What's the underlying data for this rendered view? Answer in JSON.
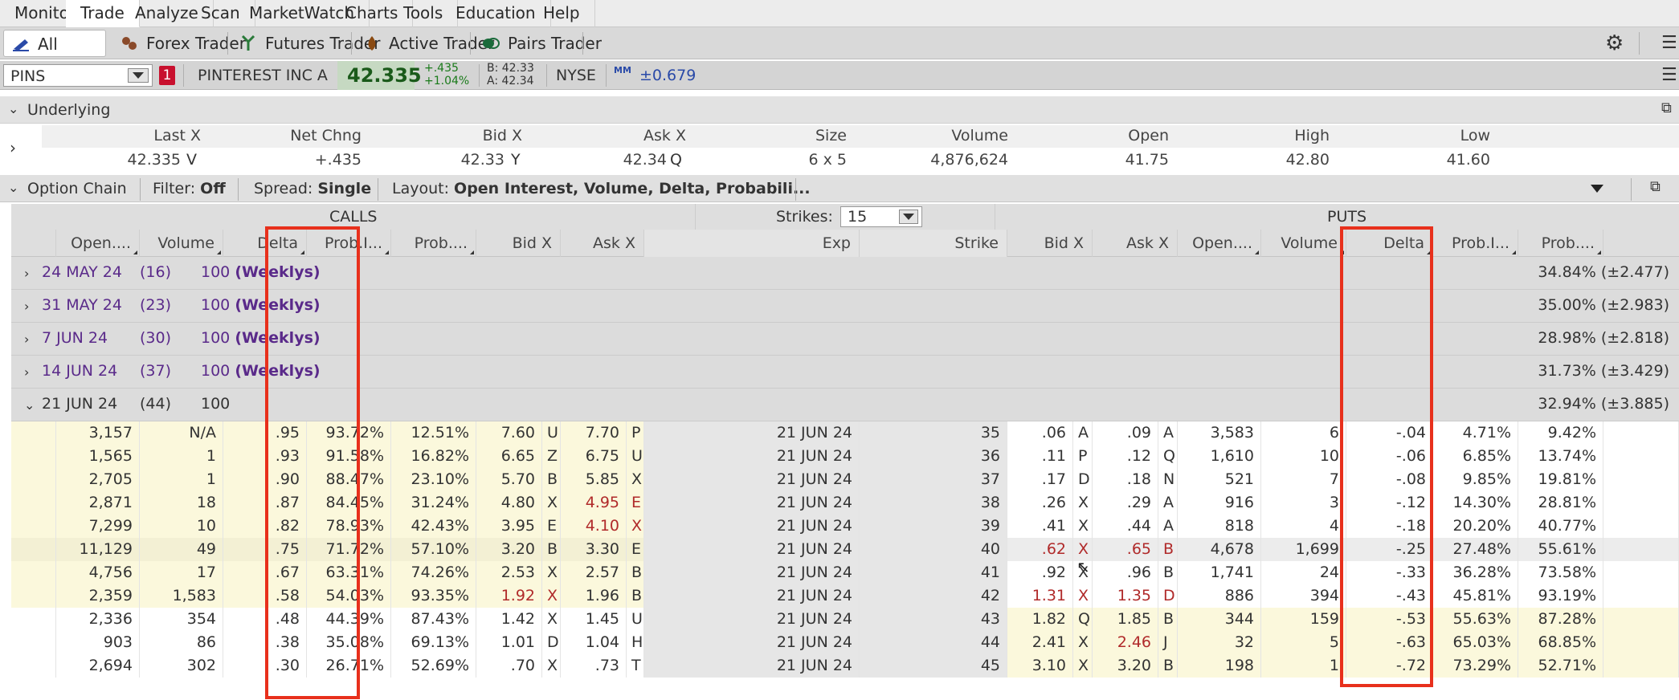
{
  "menu": [
    "Monitor",
    "Trade",
    "Analyze",
    "Scan",
    "MarketWatch",
    "Charts",
    "Tools",
    "Education",
    "Help"
  ],
  "products": [
    "All Products",
    "Forex Trader",
    "Futures Trader",
    "Active Trader",
    "Pairs Trader"
  ],
  "symbol": {
    "ticker": "PINS",
    "alert_count": "1",
    "company": "PINTEREST INC A",
    "last": "42.335",
    "change_abs": "+.435",
    "change_pct": "+1.04%",
    "bid": "B: 42.33",
    "ask": "A: 42.34",
    "exchange": "NYSE",
    "mm_label": "MM",
    "expected_move": "±0.679"
  },
  "underlying": {
    "title": "Underlying",
    "headers": [
      "Last X",
      "Net Chng",
      "Bid X",
      "Ask X",
      "Size",
      "Volume",
      "Open",
      "High",
      "Low"
    ],
    "values": {
      "last": "42.335",
      "last_ex": "V",
      "net": "+.435",
      "bid": "42.33",
      "bid_ex": "Y",
      "ask": "42.34",
      "ask_ex": "Q",
      "size": "6 x 5",
      "volume": "4,876,624",
      "open": "41.75",
      "high": "42.80",
      "low": "41.60"
    }
  },
  "chain_header": {
    "title": "Option Chain",
    "filter_label": "Filter:",
    "filter_value": "Off",
    "spread_label": "Spread:",
    "spread_value": "Single",
    "layout_label": "Layout:",
    "layout_value": "Open Interest, Volume, Delta, Probabili..."
  },
  "band": {
    "calls": "CALLS",
    "puts": "PUTS",
    "strikes_label": "Strikes:",
    "strikes_value": "15"
  },
  "columns": {
    "calls": [
      "Open....",
      "Volume",
      "Delta",
      "Prob.I...",
      "Prob....",
      "Bid X",
      "Ask X"
    ],
    "center": [
      "Exp",
      "Strike"
    ],
    "puts": [
      "Bid X",
      "Ask X",
      "Open....",
      "Volume",
      "Delta",
      "Prob.I...",
      "Prob...."
    ]
  },
  "expirations": [
    {
      "date": "24 MAY 24",
      "days": "(16)",
      "mult": "100",
      "tag": "(Weeklys)",
      "iv": "34.84% (±2.477)"
    },
    {
      "date": "31 MAY 24",
      "days": "(23)",
      "mult": "100",
      "tag": "(Weeklys)",
      "iv": "35.00% (±2.983)"
    },
    {
      "date": "7 JUN 24",
      "days": "(30)",
      "mult": "100",
      "tag": "(Weeklys)",
      "iv": "28.98% (±2.818)"
    },
    {
      "date": "14 JUN 24",
      "days": "(37)",
      "mult": "100",
      "tag": "(Weeklys)",
      "iv": "31.73% (±3.429)"
    },
    {
      "date": "21 JUN 24",
      "days": "(44)",
      "mult": "100",
      "tag": "",
      "iv": "32.94% (±3.885)"
    }
  ],
  "rows": [
    {
      "c_oi": "3,157",
      "c_vol": "N/A",
      "c_delta": ".95",
      "c_pi": "93.72%",
      "c_pt": "12.51%",
      "c_bid": "7.60",
      "c_bx": "U",
      "c_ask": "7.70",
      "c_ax": "P",
      "exp": "21 JUN 24",
      "strike": "35",
      "p_bid": ".06",
      "p_bx": "A",
      "p_ask": ".09",
      "p_ax": "A",
      "p_oi": "3,583",
      "p_vol": "6",
      "p_delta": "-.04",
      "p_pi": "4.71%",
      "p_pt": "9.42%"
    },
    {
      "c_oi": "1,565",
      "c_vol": "1",
      "c_delta": ".93",
      "c_pi": "91.58%",
      "c_pt": "16.82%",
      "c_bid": "6.65",
      "c_bx": "Z",
      "c_ask": "6.75",
      "c_ax": "U",
      "exp": "21 JUN 24",
      "strike": "36",
      "p_bid": ".11",
      "p_bx": "P",
      "p_ask": ".12",
      "p_ax": "Q",
      "p_oi": "1,610",
      "p_vol": "10",
      "p_delta": "-.06",
      "p_pi": "6.85%",
      "p_pt": "13.74%"
    },
    {
      "c_oi": "2,705",
      "c_vol": "1",
      "c_delta": ".90",
      "c_pi": "88.47%",
      "c_pt": "23.10%",
      "c_bid": "5.70",
      "c_bx": "B",
      "c_ask": "5.85",
      "c_ax": "X",
      "exp": "21 JUN 24",
      "strike": "37",
      "p_bid": ".17",
      "p_bx": "D",
      "p_ask": ".18",
      "p_ax": "N",
      "p_oi": "521",
      "p_vol": "7",
      "p_delta": "-.08",
      "p_pi": "9.85%",
      "p_pt": "19.81%"
    },
    {
      "c_oi": "2,871",
      "c_vol": "18",
      "c_delta": ".87",
      "c_pi": "84.45%",
      "c_pt": "31.24%",
      "c_bid": "4.80",
      "c_bx": "X",
      "c_ask": "4.95",
      "c_ax": "E",
      "exp": "21 JUN 24",
      "strike": "38",
      "p_bid": ".26",
      "p_bx": "X",
      "p_ask": ".29",
      "p_ax": "A",
      "p_oi": "916",
      "p_vol": "3",
      "p_delta": "-.12",
      "p_pi": "14.30%",
      "p_pt": "28.81%"
    },
    {
      "c_oi": "7,299",
      "c_vol": "10",
      "c_delta": ".82",
      "c_pi": "78.93%",
      "c_pt": "42.43%",
      "c_bid": "3.95",
      "c_bx": "E",
      "c_ask": "4.10",
      "c_ax": "X",
      "exp": "21 JUN 24",
      "strike": "39",
      "p_bid": ".41",
      "p_bx": "X",
      "p_ask": ".44",
      "p_ax": "A",
      "p_oi": "818",
      "p_vol": "4",
      "p_delta": "-.18",
      "p_pi": "20.20%",
      "p_pt": "40.77%"
    },
    {
      "c_oi": "11,129",
      "c_vol": "49",
      "c_delta": ".75",
      "c_pi": "71.72%",
      "c_pt": "57.10%",
      "c_bid": "3.20",
      "c_bx": "B",
      "c_ask": "3.30",
      "c_ax": "E",
      "exp": "21 JUN 24",
      "strike": "40",
      "p_bid": ".62",
      "p_bx": "X",
      "p_ask": ".65",
      "p_ax": "B",
      "p_oi": "4,678",
      "p_vol": "1,699",
      "p_delta": "-.25",
      "p_pi": "27.48%",
      "p_pt": "55.61%"
    },
    {
      "c_oi": "4,756",
      "c_vol": "17",
      "c_delta": ".67",
      "c_pi": "63.31%",
      "c_pt": "74.26%",
      "c_bid": "2.53",
      "c_bx": "X",
      "c_ask": "2.57",
      "c_ax": "B",
      "exp": "21 JUN 24",
      "strike": "41",
      "p_bid": ".92",
      "p_bx": "X",
      "p_ask": ".96",
      "p_ax": "B",
      "p_oi": "1,741",
      "p_vol": "24",
      "p_delta": "-.33",
      "p_pi": "36.28%",
      "p_pt": "73.58%"
    },
    {
      "c_oi": "2,359",
      "c_vol": "1,583",
      "c_delta": ".58",
      "c_pi": "54.03%",
      "c_pt": "93.35%",
      "c_bid": "1.92",
      "c_bx": "X",
      "c_ask": "1.96",
      "c_ax": "B",
      "exp": "21 JUN 24",
      "strike": "42",
      "p_bid": "1.31",
      "p_bx": "X",
      "p_ask": "1.35",
      "p_ax": "D",
      "p_oi": "886",
      "p_vol": "394",
      "p_delta": "-.43",
      "p_pi": "45.81%",
      "p_pt": "93.19%"
    },
    {
      "c_oi": "2,336",
      "c_vol": "354",
      "c_delta": ".48",
      "c_pi": "44.39%",
      "c_pt": "87.43%",
      "c_bid": "1.42",
      "c_bx": "X",
      "c_ask": "1.45",
      "c_ax": "U",
      "exp": "21 JUN 24",
      "strike": "43",
      "p_bid": "1.82",
      "p_bx": "Q",
      "p_ask": "1.85",
      "p_ax": "B",
      "p_oi": "344",
      "p_vol": "159",
      "p_delta": "-.53",
      "p_pi": "55.63%",
      "p_pt": "87.28%"
    },
    {
      "c_oi": "903",
      "c_vol": "86",
      "c_delta": ".38",
      "c_pi": "35.08%",
      "c_pt": "69.13%",
      "c_bid": "1.01",
      "c_bx": "D",
      "c_ask": "1.04",
      "c_ax": "H",
      "exp": "21 JUN 24",
      "strike": "44",
      "p_bid": "2.41",
      "p_bx": "X",
      "p_ask": "2.46",
      "p_ax": "J",
      "p_oi": "32",
      "p_vol": "5",
      "p_delta": "-.63",
      "p_pi": "65.03%",
      "p_pt": "68.85%"
    },
    {
      "c_oi": "2,694",
      "c_vol": "302",
      "c_delta": ".30",
      "c_pi": "26.71%",
      "c_pt": "52.69%",
      "c_bid": ".70",
      "c_bx": "X",
      "c_ask": ".73",
      "c_ax": "T",
      "exp": "21 JUN 24",
      "strike": "45",
      "p_bid": "3.10",
      "p_bx": "X",
      "p_ask": "3.20",
      "p_ax": "B",
      "p_oi": "198",
      "p_vol": "1",
      "p_delta": "-.72",
      "p_pi": "73.29%",
      "p_pt": "52.71%"
    }
  ],
  "colors": {
    "positive": "#1a7a1a",
    "expiration_text": "#5a2a8a",
    "itm_bg": "#fbf8dc",
    "highlight_box": "#e8301c",
    "downtick": "#b02a2a"
  }
}
